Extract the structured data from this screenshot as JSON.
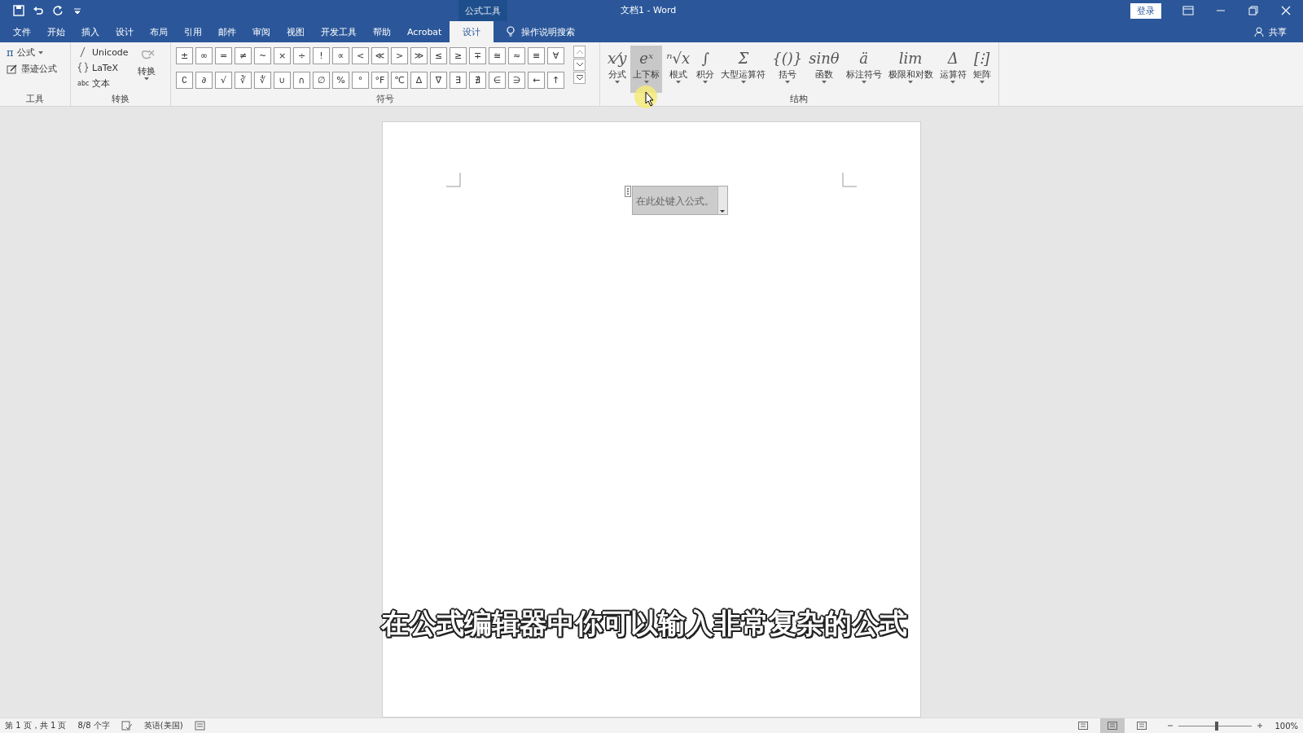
{
  "context_label": "公式工具",
  "window": {
    "title": "文档1  -  Word"
  },
  "sign_in": "登录",
  "tabs": [
    {
      "label": "文件",
      "selected": false
    },
    {
      "label": "开始",
      "selected": false
    },
    {
      "label": "插入",
      "selected": false
    },
    {
      "label": "设计",
      "selected": false
    },
    {
      "label": "布局",
      "selected": false
    },
    {
      "label": "引用",
      "selected": false
    },
    {
      "label": "邮件",
      "selected": false
    },
    {
      "label": "审阅",
      "selected": false
    },
    {
      "label": "视图",
      "selected": false
    },
    {
      "label": "开发工具",
      "selected": false
    },
    {
      "label": "帮助",
      "selected": false
    },
    {
      "label": "Acrobat",
      "selected": false
    },
    {
      "label": "设计",
      "selected": true
    }
  ],
  "tell_me": "操作说明搜索",
  "share": "共享",
  "tools": {
    "label": "工具",
    "equation_icon": "π",
    "equation": "公式",
    "ink": "墨迹公式"
  },
  "convert": {
    "label": "转换",
    "unicode": "Unicode",
    "latex": "LaTeX",
    "text_prefix": "abc",
    "text": "文本",
    "button": "转换"
  },
  "symbols": {
    "label": "符号",
    "rows": [
      [
        "±",
        "∞",
        "=",
        "≠",
        "~",
        "×",
        "÷",
        "!",
        "∝",
        "<",
        "≪",
        ">",
        "≫",
        "≤",
        "≥",
        "∓",
        "≅",
        "≈",
        "≡",
        "∀"
      ],
      [
        "∁",
        "∂",
        "√",
        "∛",
        "∜",
        "∪",
        "∩",
        "∅",
        "%",
        "°",
        "°F",
        "℃",
        "∆",
        "∇",
        "∃",
        "∄",
        "∈",
        "∋",
        "←",
        "↑"
      ]
    ]
  },
  "structures": {
    "label": "结构",
    "items": [
      {
        "glyph": "x⁄y",
        "label": "分式",
        "selected": false
      },
      {
        "glyph": "eˣ",
        "label": "上下标",
        "selected": true
      },
      {
        "glyph": "ⁿ√x",
        "label": "根式",
        "selected": false
      },
      {
        "glyph": "∫",
        "label": "积分",
        "selected": false
      },
      {
        "glyph": "Σ",
        "label": "大型运算符",
        "selected": false
      },
      {
        "glyph": "{()}",
        "label": "括号",
        "selected": false
      },
      {
        "glyph": "sinθ",
        "label": "函数",
        "selected": false
      },
      {
        "glyph": "ä",
        "label": "标注符号",
        "selected": false
      },
      {
        "glyph": "lim",
        "label": "极限和对数",
        "selected": false
      },
      {
        "glyph": "Δ",
        "label": "运算符",
        "selected": false
      },
      {
        "glyph": "[⁝]",
        "label": "矩阵",
        "selected": false
      }
    ]
  },
  "equation_placeholder": "在此处键入公式。",
  "caption": "在公式编辑器中你可以输入非常复杂的公式",
  "status_bar": {
    "page": "第 1 页，共 1 页",
    "words": "8/8 个字",
    "language": "英语(美国)",
    "views": [
      {
        "selected": false
      },
      {
        "selected": true
      },
      {
        "selected": false
      }
    ],
    "zoom": {
      "level": 0.5
    },
    "zoom_text": "100%"
  }
}
